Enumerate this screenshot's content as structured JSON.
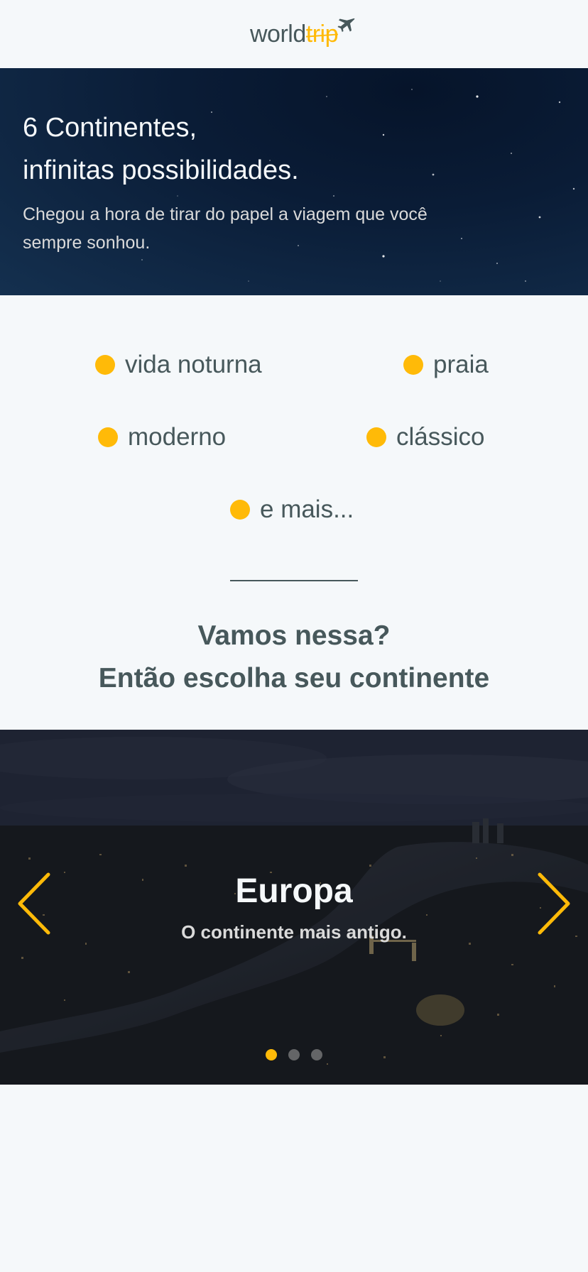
{
  "header": {
    "logo_world": "world",
    "logo_trip": "trip"
  },
  "banner": {
    "title_line1": "6 Continentes,",
    "title_line2": "infinitas possibilidades.",
    "text": "Chegou a hora de tirar do papel a viagem que você sempre sonhou."
  },
  "travel_types": [
    {
      "label": "vida noturna"
    },
    {
      "label": "praia"
    },
    {
      "label": "moderno"
    },
    {
      "label": "clássico"
    },
    {
      "label": "e mais..."
    }
  ],
  "cta": {
    "line1": "Vamos nessa?",
    "line2": "Então escolha seu continente"
  },
  "slider": {
    "title": "Europa",
    "subtitle": "O continente mais antigo.",
    "active_index": 0,
    "total": 3
  },
  "colors": {
    "highlight": "#FFBA08",
    "dark_text": "#47585B",
    "light": "#F5F8FA"
  }
}
